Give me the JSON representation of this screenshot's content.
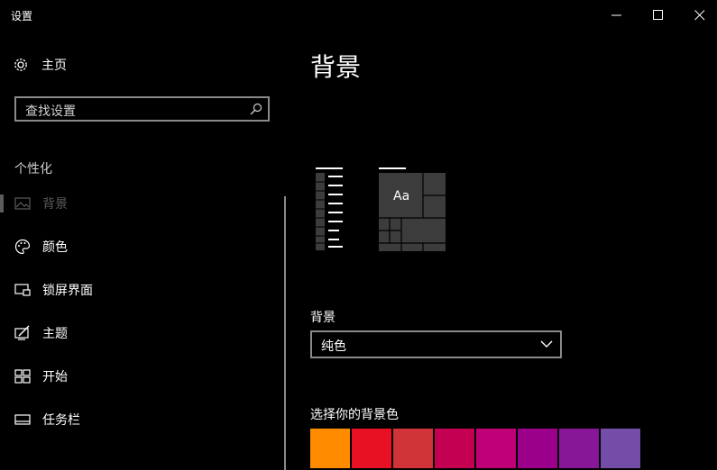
{
  "window": {
    "title": "设置"
  },
  "sidebar": {
    "home_label": "主页",
    "search_placeholder": "查找设置",
    "section_title": "个性化",
    "items": [
      {
        "label": "背景",
        "icon": "picture-icon",
        "active": true
      },
      {
        "label": "颜色",
        "icon": "palette-icon",
        "active": false
      },
      {
        "label": "锁屏界面",
        "icon": "lockscreen-icon",
        "active": false
      },
      {
        "label": "主题",
        "icon": "theme-icon",
        "active": false
      },
      {
        "label": "开始",
        "icon": "start-icon",
        "active": false
      },
      {
        "label": "任务栏",
        "icon": "taskbar-icon",
        "active": false
      }
    ]
  },
  "main": {
    "page_title": "背景",
    "preview_sample": "Aa",
    "background_label": "背景",
    "background_value": "纯色",
    "color_picker_label": "选择你的背景色",
    "swatches": [
      "#FF8C00",
      "#E81123",
      "#D13438",
      "#C30052",
      "#BF0077",
      "#9A0089",
      "#881798",
      "#744DA9"
    ]
  }
}
